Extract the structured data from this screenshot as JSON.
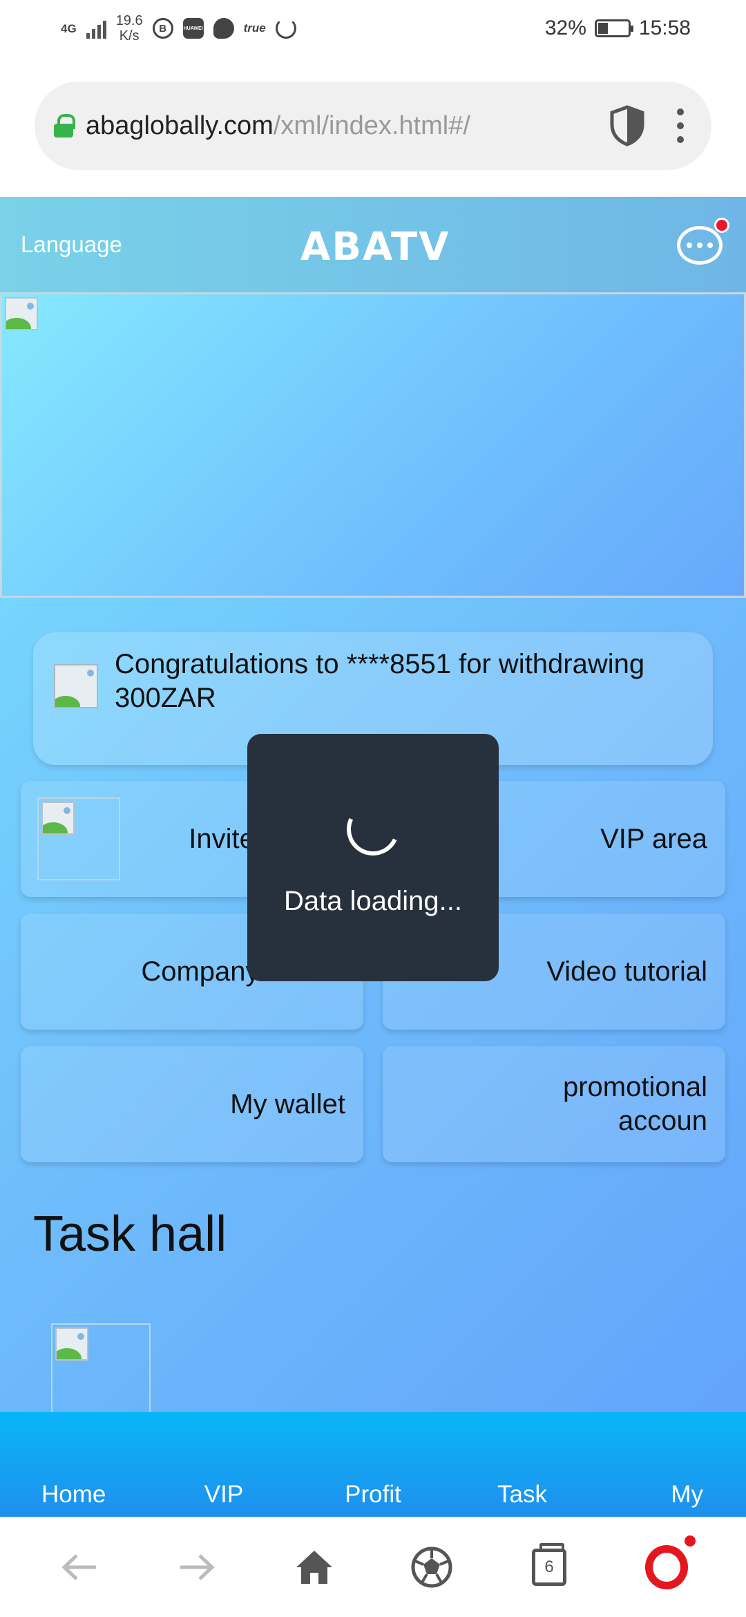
{
  "status_bar": {
    "network": "4G",
    "speed_value": "19.6",
    "speed_unit": "K/s",
    "app_icon_b": "B",
    "app_icon_huawei": "HUAWEI",
    "app_icon_true": "true",
    "battery": "32%",
    "time": "15:58"
  },
  "browser": {
    "url_domain": "abaglobally.com",
    "url_path": "/xml/index.html#/",
    "tab_count": "6"
  },
  "header": {
    "language": "Language",
    "logo": "ABATV"
  },
  "notice": {
    "text": "Congratulations to ****8551 for withdrawing 300ZAR"
  },
  "menu": {
    "invite_friends": "Invite friends",
    "vip_area": "VIP area",
    "company_profile": "Company Profile",
    "video_tutorial": "Video tutorial",
    "my_wallet": "My wallet",
    "promotional_line1": "promotional",
    "promotional_line2": "accoun"
  },
  "section": {
    "task_hall": "Task hall"
  },
  "loading": {
    "text": "Data loading..."
  },
  "bottom_nav": {
    "home": "Home",
    "vip": "VIP",
    "profit": "Profit",
    "task": "Task",
    "my": "My"
  },
  "icons": {
    "back": "back-arrow-icon",
    "forward": "forward-arrow-icon",
    "home": "home-icon",
    "soccer": "soccer-ball-icon",
    "tabs": "tabs-icon",
    "opera": "opera-icon"
  },
  "colors": {
    "page_gradient_start": "#7ae3ff",
    "page_gradient_end": "#62a1fb",
    "nav_blue": "#1f90ee",
    "toast_bg": "#27313d",
    "notification_red": "#e8172b"
  }
}
